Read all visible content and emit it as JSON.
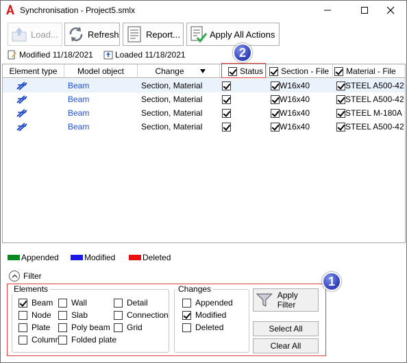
{
  "window": {
    "title": "Synchronisation - Project5.smlx",
    "minimize_icon": "minimize-icon",
    "maximize_icon": "maximize-icon",
    "close_icon": "close-icon"
  },
  "toolbar": {
    "load_label": "Load...",
    "refresh_label": "Refresh",
    "report_label": "Report...",
    "apply_all_label": "Apply All Actions"
  },
  "info": {
    "modified": "Modified 11/18/2021",
    "loaded": "Loaded 11/18/2021"
  },
  "grid": {
    "headers": {
      "element_type": "Element type",
      "model_object": "Model object",
      "change": "Change",
      "status": "Status",
      "section_file": "Section - File",
      "material_file": "Material - File"
    },
    "rows": [
      {
        "model_object": "Beam",
        "change": "Section, Material",
        "status_checked": true,
        "section": "W16x40",
        "material": "STEEL A500-42"
      },
      {
        "model_object": "Beam",
        "change": "Section, Material",
        "status_checked": true,
        "section": "W16x40",
        "material": "STEEL A500-42"
      },
      {
        "model_object": "Beam",
        "change": "Section, Material",
        "status_checked": true,
        "section": "W16x40",
        "material": "STEEL M-180A"
      },
      {
        "model_object": "Beam",
        "change": "Section, Material",
        "status_checked": true,
        "section": "W16x40",
        "material": "STEEL A500-42"
      }
    ]
  },
  "legend": {
    "appended": {
      "label": "Appended",
      "color": "#0a8a1e"
    },
    "modified": {
      "label": "Modified",
      "color": "#1a1ae6"
    },
    "deleted": {
      "label": "Deleted",
      "color": "#e81010"
    }
  },
  "filter": {
    "toggle_label": "Filter",
    "elements": {
      "title": "Elements",
      "items": [
        {
          "label": "Beam",
          "checked": true
        },
        {
          "label": "Wall",
          "checked": false
        },
        {
          "label": "Detail",
          "checked": false
        },
        {
          "label": "Node",
          "checked": false
        },
        {
          "label": "Slab",
          "checked": false
        },
        {
          "label": "Connection",
          "checked": false
        },
        {
          "label": "Plate",
          "checked": false
        },
        {
          "label": "Poly beam",
          "checked": false
        },
        {
          "label": "Grid",
          "checked": false
        },
        {
          "label": "Column",
          "checked": false
        },
        {
          "label": "Folded plate",
          "checked": false
        }
      ]
    },
    "changes": {
      "title": "Changes",
      "items": [
        {
          "label": "Appended",
          "checked": false
        },
        {
          "label": "Modified",
          "checked": true
        },
        {
          "label": "Deleted",
          "checked": false
        }
      ]
    },
    "apply_filter_label": "Apply Filter",
    "select_all_label": "Select All",
    "clear_all_label": "Clear All"
  },
  "callouts": {
    "one": "1",
    "two": "2"
  }
}
